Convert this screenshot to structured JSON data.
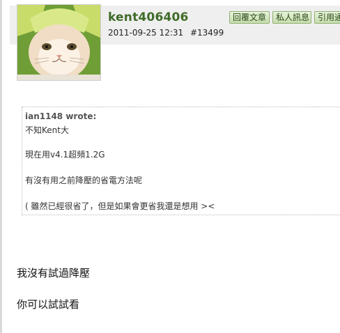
{
  "post": {
    "username": "kent406406",
    "timestamp": "2011-09-25 12:31",
    "post_number": "#13499",
    "buttons": {
      "reply": "回覆文章",
      "private_message": "私人訊息",
      "quote": "引用通"
    }
  },
  "quote": {
    "author": "ian1148 wrote:",
    "lines": [
      "不知Kent大",
      "現在用v4.1超頻1.2G",
      "有沒有用之前降壓的省電方法呢",
      "( 雖然已經很省了，但是如果會更省我還是想用 ><"
    ]
  },
  "message": {
    "lines": [
      "我沒有試過降壓",
      "你可以試試看"
    ]
  },
  "colors": {
    "username": "#3f6b29",
    "button_bg": "#c6ddad",
    "header_band": "#efefef"
  }
}
